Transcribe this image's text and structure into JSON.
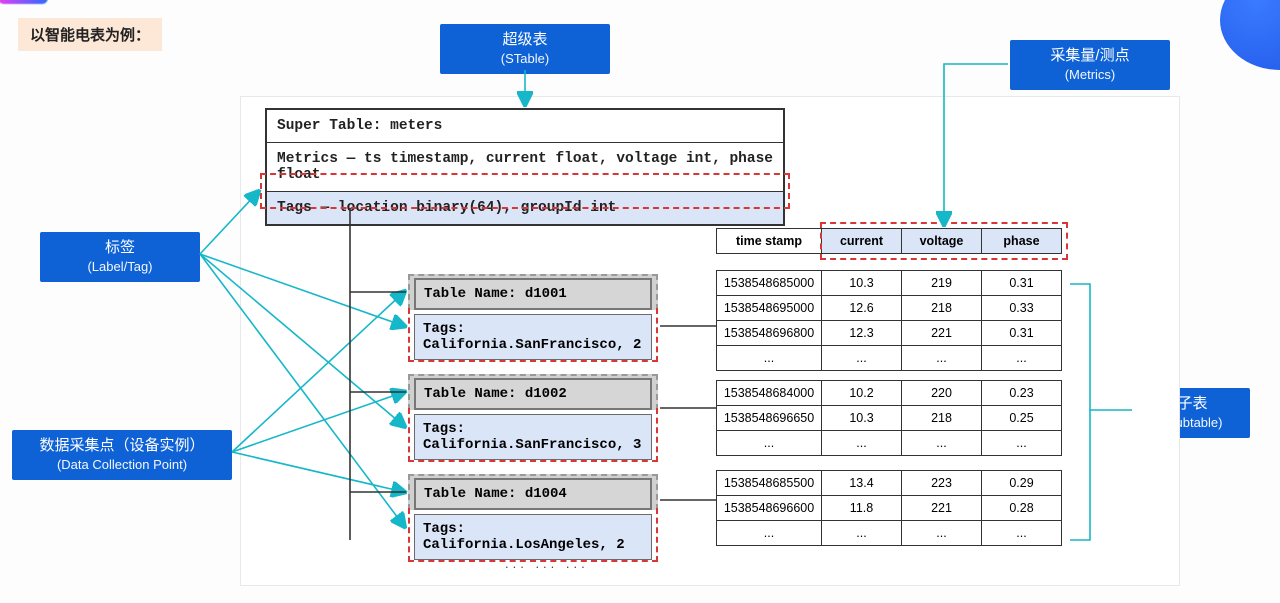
{
  "title": "以智能电表为例：",
  "callouts": {
    "stable": {
      "top": "超级表",
      "sub": "(STable)"
    },
    "metrics": {
      "top": "采集量/测点",
      "sub": "(Metrics)"
    },
    "labeltag": {
      "top": "标签",
      "sub": "(Label/Tag)"
    },
    "dcp": {
      "top": "数据采集点（设备实例）",
      "sub": "(Data Collection Point)"
    },
    "subtable": {
      "top": "子表",
      "sub": "(Subtable)"
    }
  },
  "super_table": {
    "title": "Super Table: meters",
    "metrics": "Metrics — ts timestamp, current float, voltage int, phase float",
    "tags": "Tags — location binary(64), groupId int"
  },
  "subtables": [
    {
      "name": "Table Name: d1001",
      "tags": "Tags: California.SanFrancisco, 2"
    },
    {
      "name": "Table Name: d1002",
      "tags": "Tags: California.SanFrancisco, 3"
    },
    {
      "name": "Table Name: d1004",
      "tags": "Tags: California.LosAngeles, 2"
    }
  ],
  "headers": {
    "ts": "time stamp",
    "current": "current",
    "voltage": "voltage",
    "phase": "phase"
  },
  "data": {
    "d1001": [
      {
        "ts": "1538548685000",
        "current": "10.3",
        "voltage": "219",
        "phase": "0.31"
      },
      {
        "ts": "1538548695000",
        "current": "12.6",
        "voltage": "218",
        "phase": "0.33"
      },
      {
        "ts": "1538548696800",
        "current": "12.3",
        "voltage": "221",
        "phase": "0.31"
      },
      {
        "ts": "...",
        "current": "...",
        "voltage": "...",
        "phase": "..."
      }
    ],
    "d1002": [
      {
        "ts": "1538548684000",
        "current": "10.2",
        "voltage": "220",
        "phase": "0.23"
      },
      {
        "ts": "1538548696650",
        "current": "10.3",
        "voltage": "218",
        "phase": "0.25"
      },
      {
        "ts": "...",
        "current": "...",
        "voltage": "...",
        "phase": "..."
      }
    ],
    "d1004": [
      {
        "ts": "1538548685500",
        "current": "13.4",
        "voltage": "223",
        "phase": "0.29"
      },
      {
        "ts": "1538548696600",
        "current": "11.8",
        "voltage": "221",
        "phase": "0.28"
      },
      {
        "ts": "...",
        "current": "...",
        "voltage": "...",
        "phase": "..."
      }
    ]
  },
  "bottom_ellipsis": "... ... ..."
}
